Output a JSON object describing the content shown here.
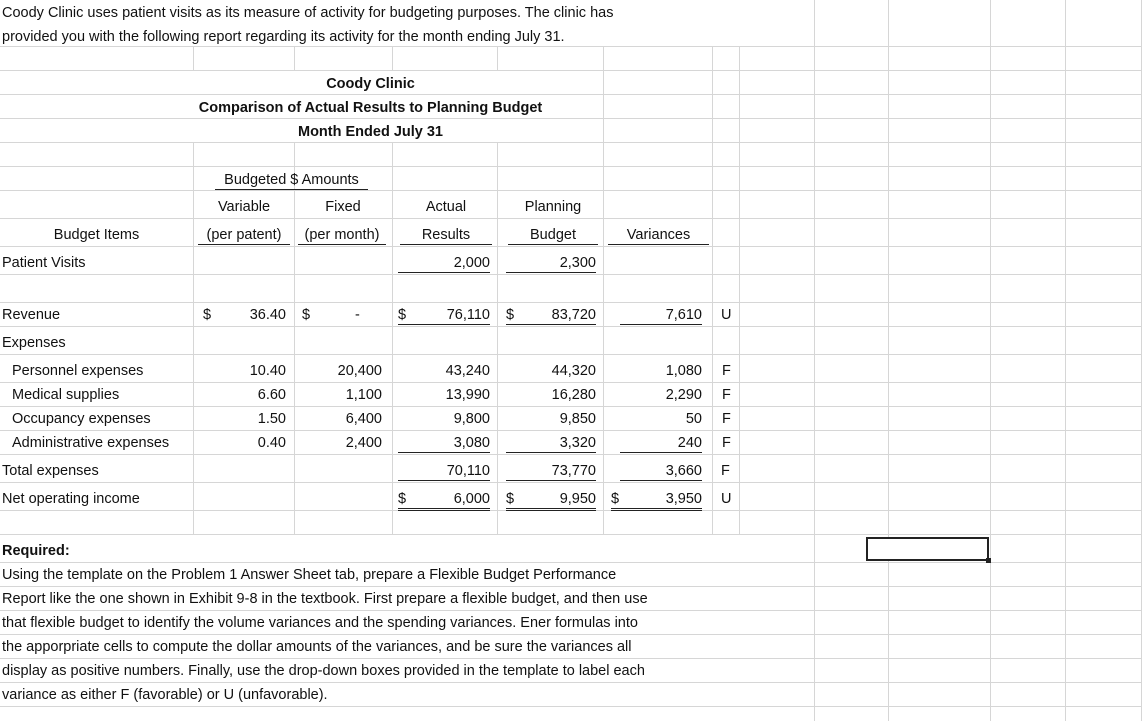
{
  "intro": [
    "Coody Clinic uses patient visits as its measure of activity for budgeting purposes.  The clinic has",
    "provided you with the following report regarding its activity for the month ending July 31."
  ],
  "report": {
    "title": "Coody Clinic",
    "subtitle": "Comparison of Actual Results to Planning Budget",
    "period": "Month Ended July 31"
  },
  "headers": {
    "budgeted_amounts": "Budgeted $ Amounts",
    "variable": "Variable",
    "fixed": "Fixed",
    "per_patent": "(per patent)",
    "per_month": "(per month)",
    "actual": "Actual",
    "results": "Results",
    "planning": "Planning",
    "budget": "Budget",
    "variances": "Variances",
    "budget_items": "Budget Items"
  },
  "patient_visits": {
    "label": "Patient Visits",
    "actual": "2,000",
    "planning": "2,300"
  },
  "revenue": {
    "label": "Revenue",
    "var_dollar": "$",
    "variable": "36.40",
    "fix_dollar": "$",
    "fixed": "-",
    "act_dollar": "$",
    "actual": "76,110",
    "plan_dollar": "$",
    "planning": "83,720",
    "variance": "7,610",
    "fu": "U"
  },
  "expenses_label": "Expenses",
  "expense_rows": [
    {
      "label": "Personnel expenses",
      "variable": "10.40",
      "fixed": "20,400",
      "actual": "43,240",
      "planning": "44,320",
      "variance": "1,080",
      "fu": "F"
    },
    {
      "label": "Medical supplies",
      "variable": "6.60",
      "fixed": "1,100",
      "actual": "13,990",
      "planning": "16,280",
      "variance": "2,290",
      "fu": "F"
    },
    {
      "label": "Occupancy expenses",
      "variable": "1.50",
      "fixed": "6,400",
      "actual": "9,800",
      "planning": "9,850",
      "variance": "50",
      "fu": "F"
    },
    {
      "label": "Administrative expenses",
      "variable": "0.40",
      "fixed": "2,400",
      "actual": "3,080",
      "planning": "3,320",
      "variance": "240",
      "fu": "F"
    }
  ],
  "total_expenses": {
    "label": "Total expenses",
    "actual": "70,110",
    "planning": "73,770",
    "variance": "3,660",
    "fu": "F"
  },
  "net_income": {
    "label": "Net operating income",
    "act_dollar": "$",
    "actual": "6,000",
    "plan_dollar": "$",
    "planning": "9,950",
    "var_dollar": "$",
    "variance": "3,950",
    "fu": "U"
  },
  "required": {
    "heading": "Required:",
    "lines": [
      "Using the template on the Problem 1 Answer Sheet tab, prepare a Flexible Budget Performance",
      "Report like the one shown in Exhibit 9-8 in the textbook. First prepare a flexible budget, and then use",
      "that flexible budget to identify the volume variances and the spending variances.  Ener formulas into",
      "the apporpriate cells to compute the dollar amounts of the variances, and be sure the variances all",
      "display as positive numbers.  Finally, use the drop-down boxes provided in the template to label each",
      "variance as either F (favorable) or U (unfavorable)."
    ]
  },
  "colors": {
    "gridline": "#d4d4d4",
    "text": "#111111",
    "selection": "#222222"
  }
}
